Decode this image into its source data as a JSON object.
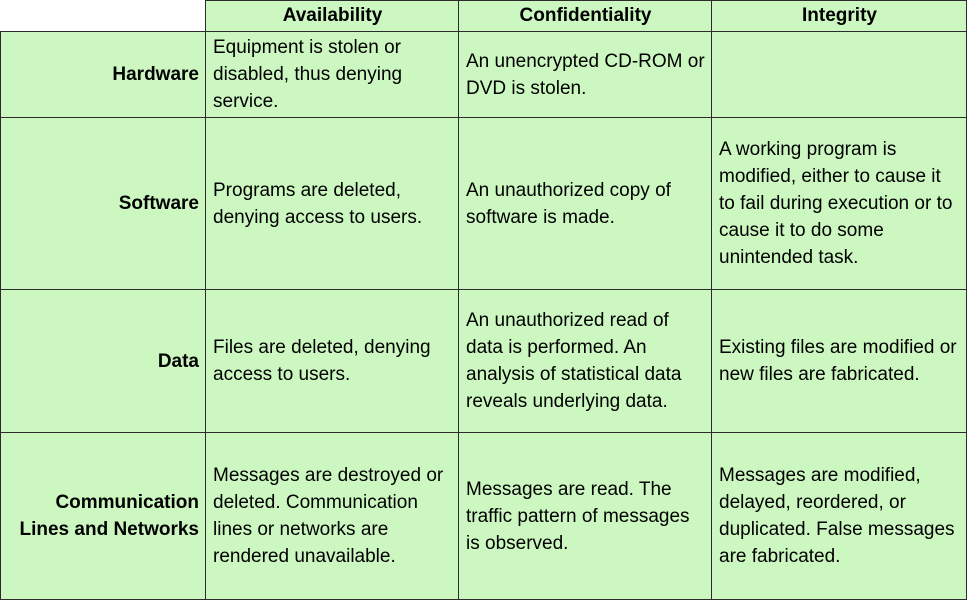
{
  "columns": {
    "availability": "Availability",
    "confidentiality": "Confidentiality",
    "integrity": "Integrity"
  },
  "rows": [
    {
      "label": "Hardware",
      "availability": "Equipment is stolen or disabled, thus denying service.",
      "confidentiality": "An unencrypted CD-ROM or DVD is stolen.",
      "integrity": ""
    },
    {
      "label": "Software",
      "availability": "Programs are deleted, denying access to users.",
      "confidentiality": "An unauthorized copy of software is made.",
      "integrity": "A working program is modified, either to cause it to fail during execution or to cause it to do some unintended task."
    },
    {
      "label": "Data",
      "availability": "Files are deleted, denying access to users.",
      "confidentiality": "An unauthorized read of data is performed. An analysis of statistical data reveals underlying data.",
      "integrity": "Existing files are modified or new files are fabricated."
    },
    {
      "label": "Communication Lines and Networks",
      "availability": "Messages are destroyed or deleted. Communication lines or networks are rendered unavailable.",
      "confidentiality": "Messages are read. The traffic pattern of messages is observed.",
      "integrity": "Messages are modified, delayed, reordered, or duplicated. False messages are fabricated."
    }
  ]
}
